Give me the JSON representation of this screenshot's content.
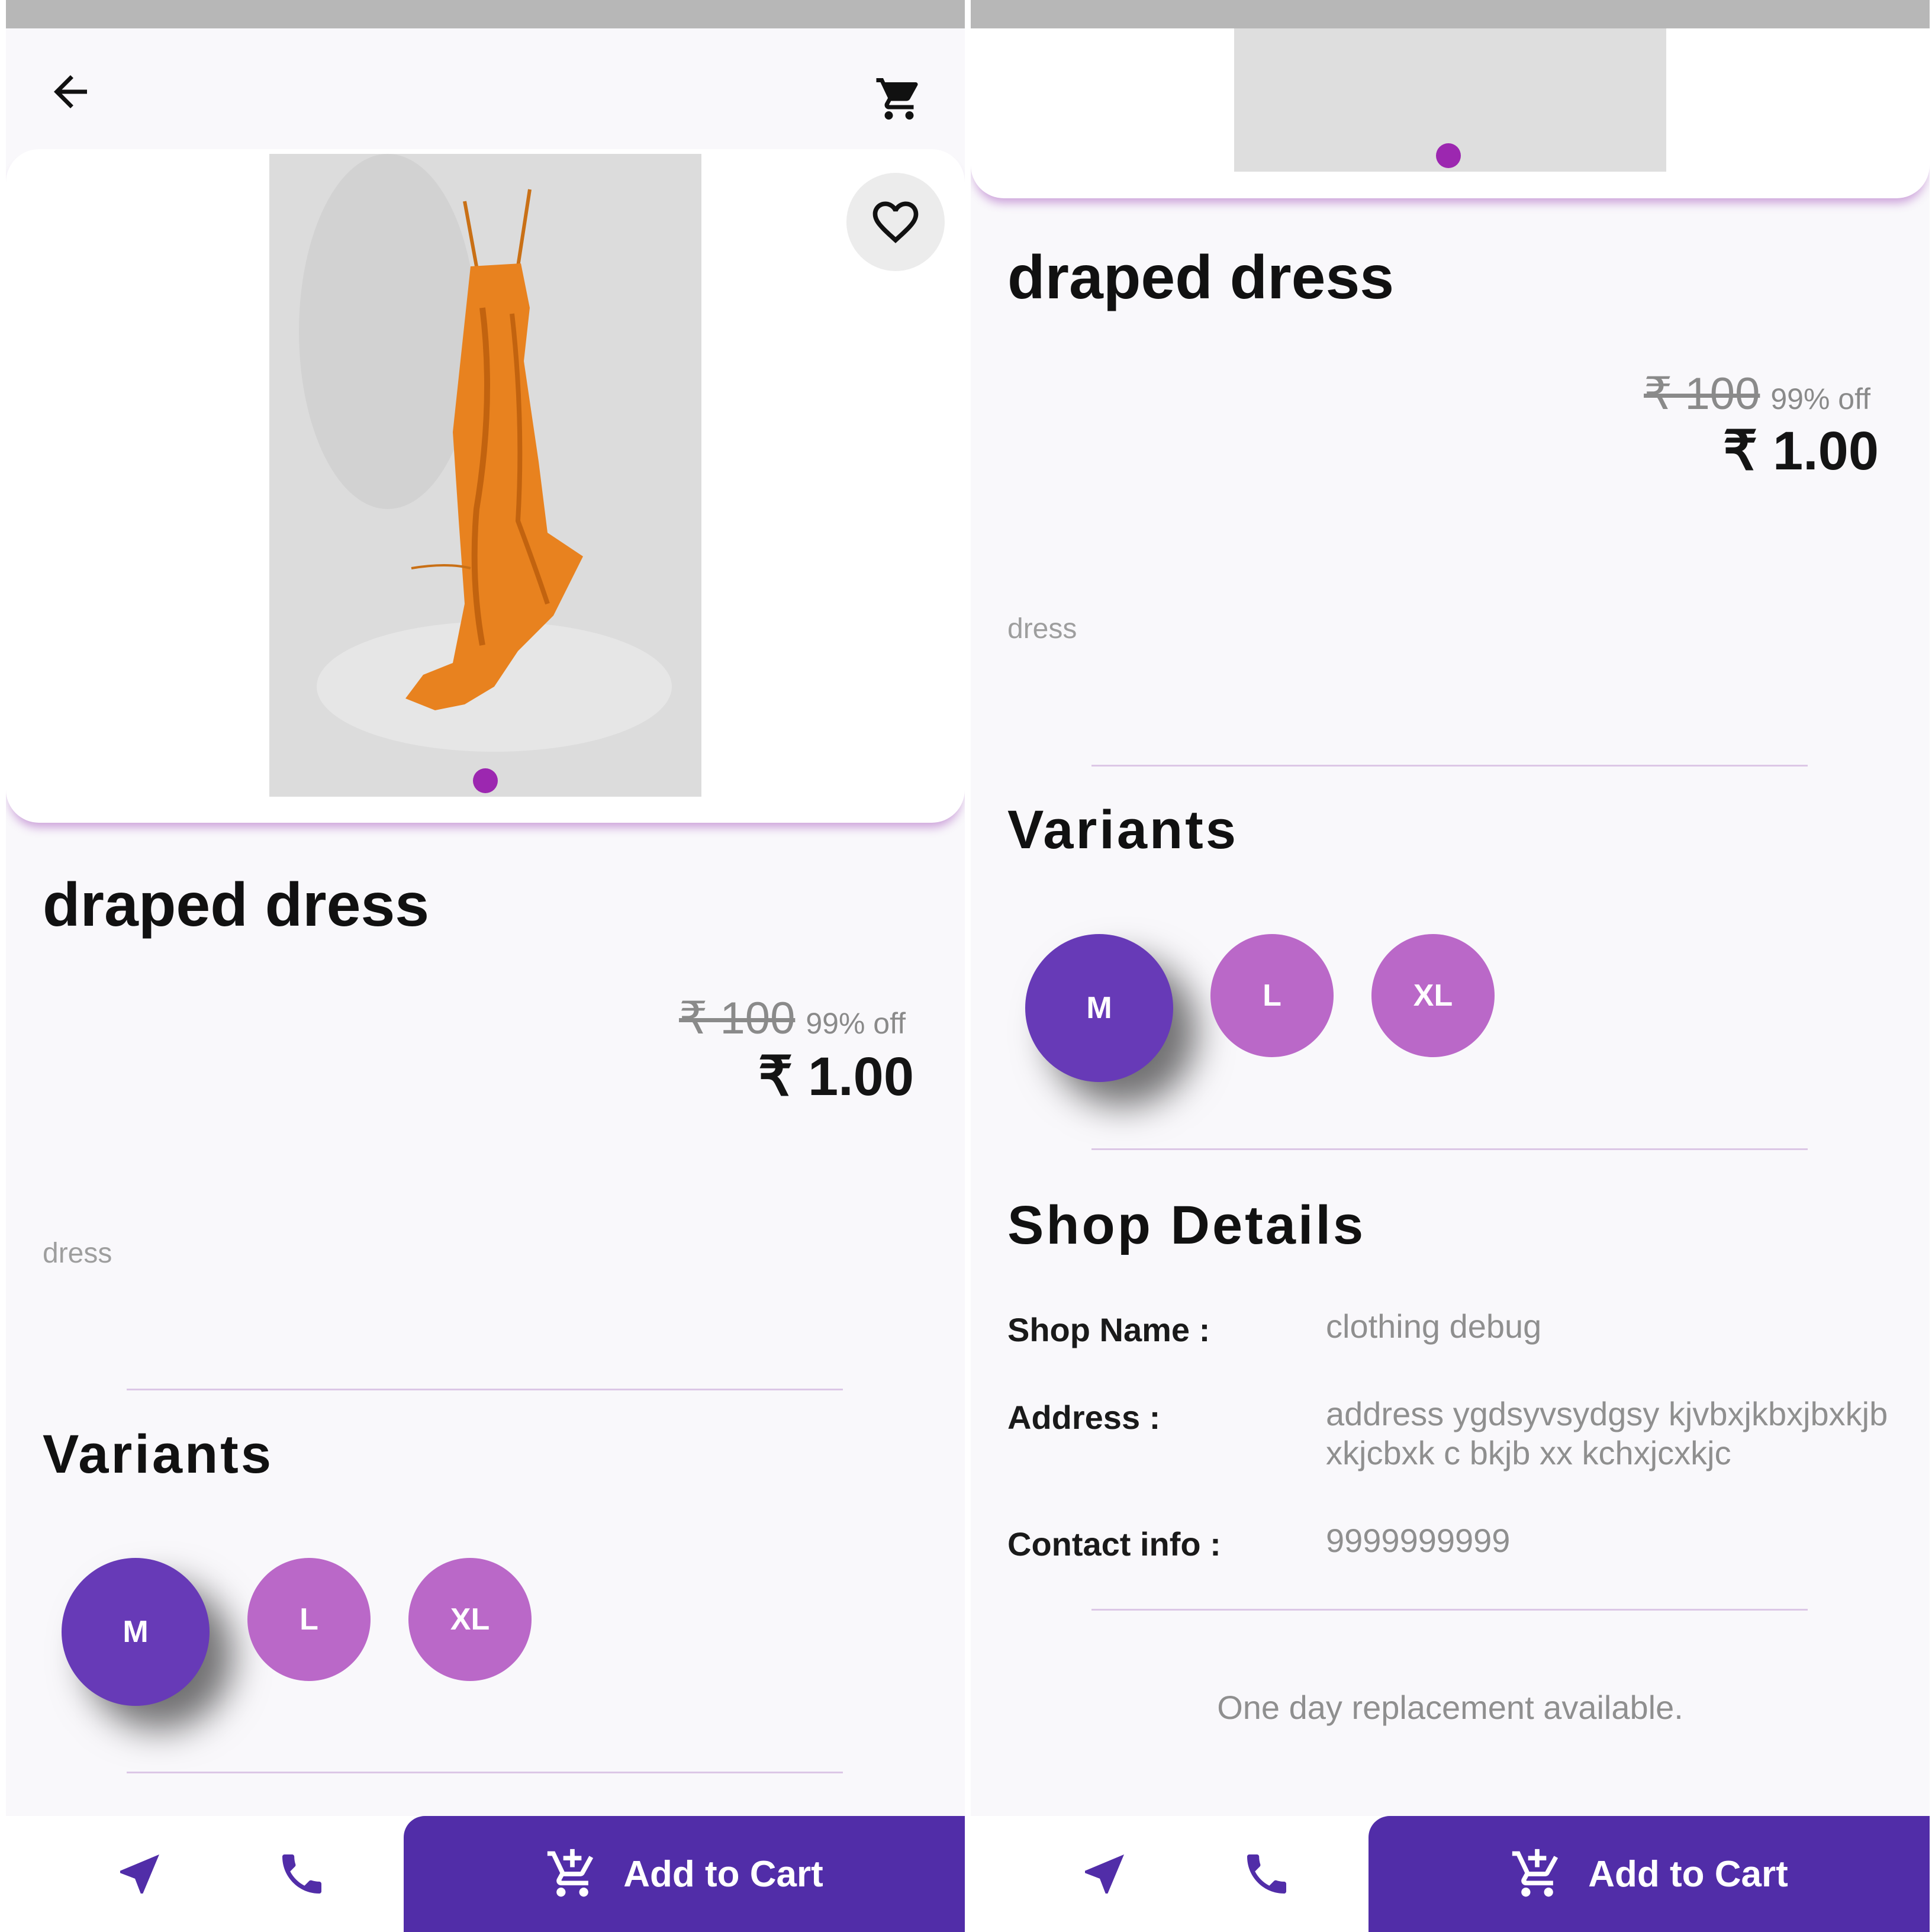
{
  "product": {
    "title": "draped dress",
    "mrp": "₹ 100",
    "discount": "99% off",
    "price": "₹ 1.00",
    "category": "dress"
  },
  "variants": {
    "heading": "Variants",
    "options": [
      "M",
      "L",
      "XL"
    ],
    "selected": "M"
  },
  "shop": {
    "heading": "Shop Details",
    "name_label": "Shop Name :",
    "name_value": "clothing debug",
    "address_label": "Address :",
    "address_value": "address ygdsyvsydgsy  kjvbxjkbxjbxkjb xkjcbxk c bkjb xx kchxjcxkjc",
    "contact_label": "Contact info :",
    "contact_value": "9999999999"
  },
  "replacement_text": "One day replacement available.",
  "bottom_bar": {
    "add_to_cart_label": "Add to Cart"
  },
  "icons": {
    "back": "arrow-left-icon",
    "cart": "shopping-cart-icon",
    "favorite": "heart-outline-icon",
    "navigate": "navigation-arrow-icon",
    "call": "phone-icon",
    "add_cart": "add-shopping-cart-icon"
  },
  "colors": {
    "primary": "#512da8",
    "variant_selected": "#673ab7",
    "variant_unselected": "#ba68c8",
    "page_indicator": "#9c27b0",
    "product_orange": "#e8821f"
  }
}
